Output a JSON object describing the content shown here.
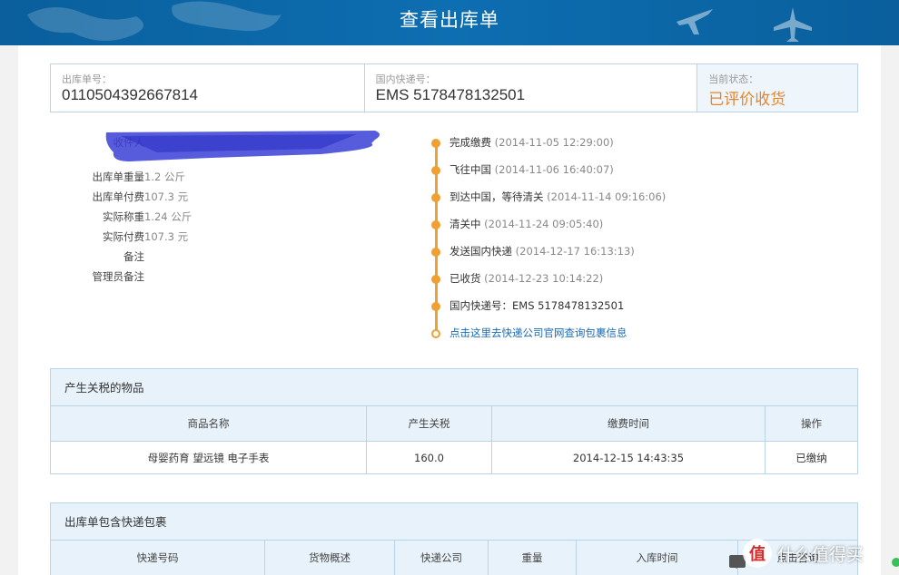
{
  "header": {
    "title": "查看出库单"
  },
  "order_info": {
    "order_no_label": "出库单号：",
    "order_no": "0110504392667814",
    "courier_label": "国内快递号：",
    "courier_no": "EMS 5178478132501",
    "status_label": "当前状态：",
    "status": "已评价收货"
  },
  "details": {
    "recipient_label": "收件人",
    "weight_label": "出库单重量",
    "weight": "1.2 公斤",
    "fee_label": "出库单付费",
    "fee": "107.3 元",
    "actual_weight_label": "实际称重",
    "actual_weight": "1.24 公斤",
    "actual_fee_label": "实际付费",
    "actual_fee": "107.3 元",
    "note_label": "备注",
    "admin_note_label": "管理员备注"
  },
  "timeline": [
    {
      "event": "完成缴费",
      "time": "(2014-11-05 12:29:00)"
    },
    {
      "event": "飞往中国",
      "time": "(2014-11-06 16:40:07)"
    },
    {
      "event": "到达中国，等待清关",
      "time": "(2014-11-14 09:16:06)"
    },
    {
      "event": "清关中",
      "time": "(2014-11-24 09:05:40)"
    },
    {
      "event": "发送国内快递",
      "time": "(2014-12-17 16:13:13)"
    },
    {
      "event": "已收货",
      "time": "(2014-12-23 10:14:22)"
    },
    {
      "event": "国内快递号：EMS 5178478132501",
      "time": ""
    },
    {
      "event": "点击这里去快递公司官网查询包裹信息",
      "time": ""
    }
  ],
  "tax_panel": {
    "title": "产生关税的物品",
    "columns": [
      "商品名称",
      "产生关税",
      "缴费时间",
      "操作"
    ],
    "rows": [
      [
        "母婴药育 望远镜 电子手表",
        "160.0",
        "2014-12-15 14:43:35",
        "已缴纳"
      ]
    ]
  },
  "package_panel": {
    "title": "出库单包含快递包裹",
    "columns": [
      "快递号码",
      "货物概述",
      "快递公司",
      "重量",
      "入库时间",
      "点击咨询"
    ]
  },
  "watermark": {
    "logo": "值",
    "text": "什么值得买"
  },
  "colors": {
    "header": "#0b67a6",
    "accent": "#f0a030",
    "border": "#b9d3e8",
    "panel_bg": "#e8f2fa"
  }
}
